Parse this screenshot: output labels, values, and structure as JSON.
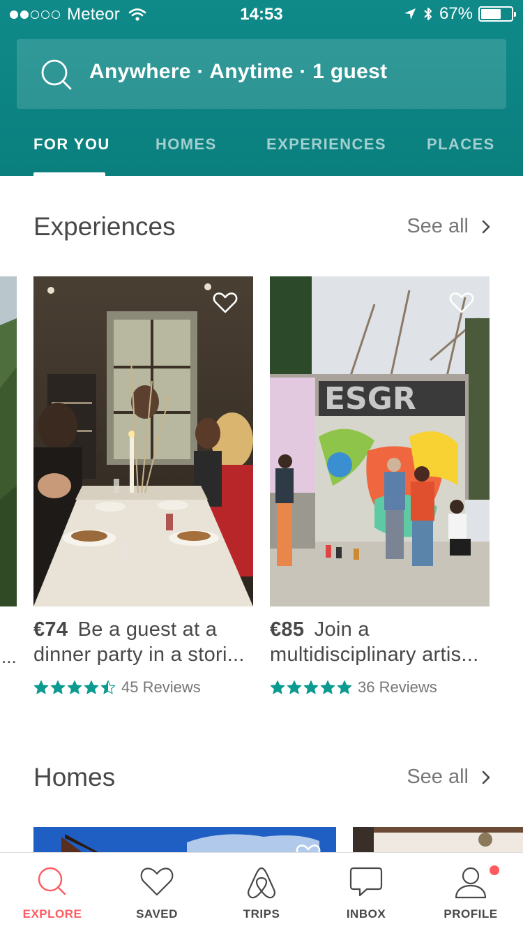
{
  "status_bar": {
    "carrier": "Meteor",
    "time": "14:53",
    "battery": "67%",
    "battery_level": 0.67,
    "signal_bars_filled": 2,
    "signal_bars_total": 5
  },
  "search": {
    "text": "Anywhere · Anytime · 1 guest"
  },
  "tabs": [
    {
      "label": "FOR YOU",
      "active": true
    },
    {
      "label": "HOMES",
      "active": false
    },
    {
      "label": "EXPERIENCES",
      "active": false
    },
    {
      "label": "PLACES",
      "active": false
    }
  ],
  "experiences": {
    "title": "Experiences",
    "see_all": "See all",
    "cards": [
      {
        "price": "€74",
        "title_line1": "Be a guest at a",
        "title_line2": "dinner party in a stori...",
        "rating": 4.5,
        "reviews": "45 Reviews"
      },
      {
        "price": "€85",
        "title_line1": "Join a",
        "title_line2": "multidisciplinary artis...",
        "rating": 5,
        "reviews": "36 Reviews"
      }
    ],
    "previous_card_tail": "..."
  },
  "homes": {
    "title": "Homes",
    "see_all": "See all"
  },
  "bottom_nav": [
    {
      "label": "EXPLORE",
      "icon": "search-icon",
      "active": true
    },
    {
      "label": "SAVED",
      "icon": "heart-icon",
      "active": false
    },
    {
      "label": "TRIPS",
      "icon": "airbnb-logo-icon",
      "active": false
    },
    {
      "label": "INBOX",
      "icon": "chat-bubble-icon",
      "active": false
    },
    {
      "label": "PROFILE",
      "icon": "person-icon",
      "active": false,
      "notification": true
    }
  ],
  "colors": {
    "header": "#0d8584",
    "accent": "#ff5a5f",
    "star": "#0a9a8f",
    "text": "#484848",
    "muted": "#767676"
  }
}
